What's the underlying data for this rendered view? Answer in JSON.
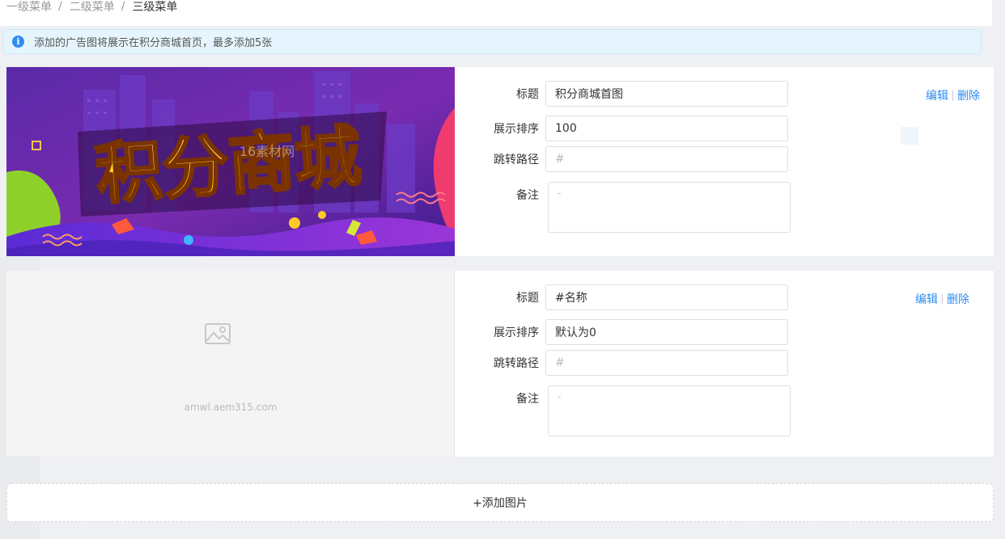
{
  "breadcrumb": [
    "一级菜单",
    "二级菜单",
    "三级菜单"
  ],
  "breadcrumb_separator": "/",
  "alert": {
    "icon": "info-icon",
    "text": "添加的广告图将展示在积分商城首页，最多添加5张"
  },
  "banner": {
    "headline": "积分商城",
    "watermark": "16素材网"
  },
  "labels": {
    "title": "标题",
    "order": "展示排序",
    "path": "跳转路径",
    "note": "备注"
  },
  "cards": [
    {
      "title_value": "积分商城首图",
      "order_value": "100",
      "path_placeholder": "#",
      "note_placeholder": "-",
      "edit_label": "编辑",
      "delete_label": "删除"
    },
    {
      "title_value": "#名称",
      "order_value": "默认为0",
      "path_placeholder": "#",
      "note_placeholder": "-",
      "edit_label": "编辑",
      "delete_label": "删除",
      "placeholder_text": "amwl.aem315.com"
    }
  ],
  "add_button_label": "+添加图片",
  "colors": {
    "accent": "#2d8cf0",
    "alert_bg": "#e6f5fd",
    "page_bg": "#eef0f3"
  }
}
